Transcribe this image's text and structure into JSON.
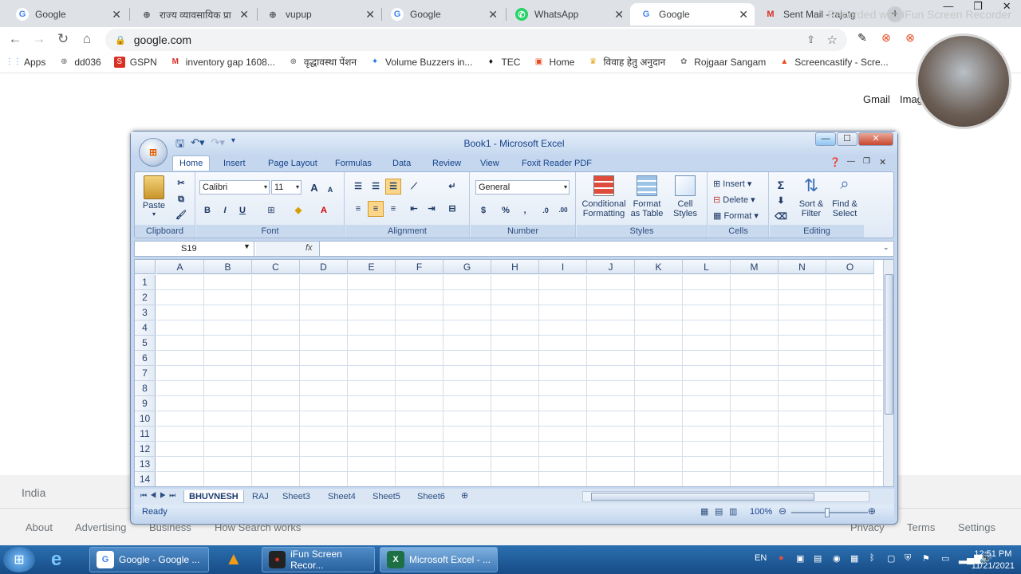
{
  "browser": {
    "tabs": [
      {
        "label": "Google",
        "icon": "G",
        "color": "#4285f4"
      },
      {
        "label": "राज्य व्यावसायिक प्रा",
        "icon": "⊕",
        "color": "#5f6368"
      },
      {
        "label": "vupup",
        "icon": "⊕",
        "color": "#5f6368"
      },
      {
        "label": "Google",
        "icon": "G",
        "color": "#4285f4"
      },
      {
        "label": "WhatsApp",
        "icon": "✆",
        "color": "#25d366"
      },
      {
        "label": "Google",
        "icon": "G",
        "color": "#4285f4"
      },
      {
        "label": "Sent Mail - rajatg",
        "icon": "M",
        "color": "#d93025"
      }
    ],
    "new_tab": "+",
    "url": "google.com",
    "watermark": "Recorded with iFun Screen Recorder",
    "bookmarks": [
      {
        "label": "Apps",
        "icon": "⋮⋮",
        "color": "#4285f4"
      },
      {
        "label": "dd036",
        "icon": "⊕",
        "color": "#5f6368"
      },
      {
        "label": "GSPN",
        "icon": "S",
        "color": "#d93025"
      },
      {
        "label": "inventory gap 1608...",
        "icon": "M",
        "color": "#d93025"
      },
      {
        "label": "वृद्धावस्था पेंशन",
        "icon": "⊕",
        "color": "#5f6368"
      },
      {
        "label": "Volume Buzzers in...",
        "icon": "✦",
        "color": "#1a73e8"
      },
      {
        "label": "TEC",
        "icon": "♦",
        "color": "#111"
      },
      {
        "label": "Home",
        "icon": "▣",
        "color": "#e8491d"
      },
      {
        "label": "विवाह हेतु अनुदान",
        "icon": "♛",
        "color": "#e8a31d"
      },
      {
        "label": "Rojgaar Sangam",
        "icon": "✿",
        "color": "#777"
      },
      {
        "label": "Screencastify - Scre...",
        "icon": "▲",
        "color": "#e8491d"
      }
    ]
  },
  "google": {
    "gmail": "Gmail",
    "images": "Imag",
    "country": "India",
    "footer": [
      "About",
      "Advertising",
      "Business",
      "How Search works",
      "Privacy",
      "Terms",
      "Settings"
    ]
  },
  "excel": {
    "title": "Book1 - Microsoft Excel",
    "office_letter": "⊞",
    "ribbon_tabs": [
      "Home",
      "Insert",
      "Page Layout",
      "Formulas",
      "Data",
      "Review",
      "View",
      "Foxit Reader PDF"
    ],
    "clipboard": {
      "paste": "Paste",
      "label": "Clipboard"
    },
    "font": {
      "name": "Calibri",
      "size": "11",
      "grow": "A",
      "shrink": "A",
      "bold": "B",
      "italic": "I",
      "underline": "U",
      "label": "Font"
    },
    "alignment": {
      "label": "Alignment"
    },
    "number": {
      "format": "General",
      "currency": "$",
      "percent": "%",
      "comma": ",",
      "label": "Number",
      "inc": ".0",
      "dec": ".00"
    },
    "styles": {
      "conditional": "Conditional",
      "conditional2": "Formatting",
      "format_table": "Format",
      "format_table2": "as Table",
      "cell_styles": "Cell",
      "cell_styles2": "Styles",
      "label": "Styles"
    },
    "cells": {
      "insert": "Insert",
      "delete": "Delete",
      "format": "Format",
      "label": "Cells"
    },
    "editing": {
      "sum": "Σ",
      "sort": "Sort &",
      "sort2": "Filter",
      "find": "Find &",
      "find2": "Select",
      "label": "Editing"
    },
    "name_box": "S19",
    "fx": "fx",
    "columns": [
      "A",
      "B",
      "C",
      "D",
      "E",
      "F",
      "G",
      "H",
      "I",
      "J",
      "K",
      "L",
      "M",
      "N",
      "O"
    ],
    "rows": [
      "1",
      "2",
      "3",
      "4",
      "5",
      "6",
      "7",
      "8",
      "9",
      "10",
      "11",
      "12",
      "13",
      "14"
    ],
    "sheets": [
      "BHUVNESH",
      "RAJ",
      "Sheet3",
      "Sheet4",
      "Sheet5",
      "Sheet6"
    ],
    "status": "Ready",
    "zoom": "100%"
  },
  "taskbar": {
    "items": [
      {
        "label": "Google - Google ...",
        "icon": "G",
        "color": "#4285f4"
      },
      {
        "label": "iFun Screen Recor...",
        "icon": "●",
        "color": "#d93025"
      },
      {
        "label": "Microsoft Excel - ...",
        "icon": "X",
        "color": "#1d7044"
      }
    ],
    "lang": "EN",
    "time": "12:51 PM",
    "date": "11/21/2021"
  }
}
